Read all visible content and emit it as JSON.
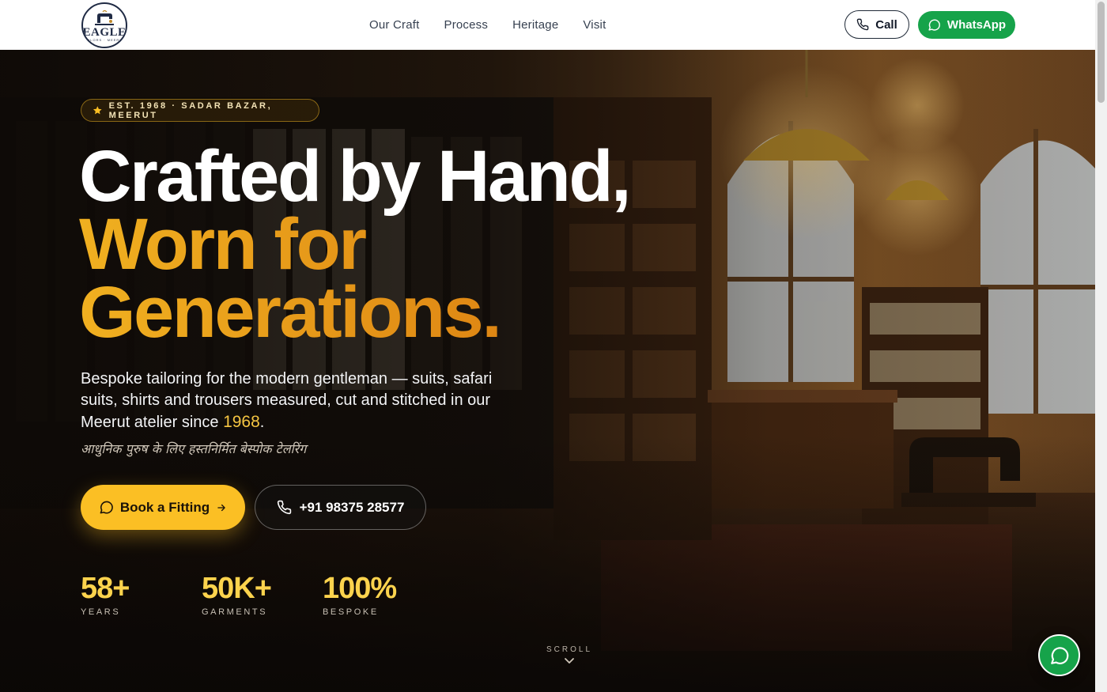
{
  "header": {
    "logo_text": "EAGLE",
    "logo_sub": "TAILORS · MEERUT",
    "nav": [
      "Our Craft",
      "Process",
      "Heritage",
      "Visit"
    ],
    "call_label": "Call",
    "whatsapp_label": "WhatsApp"
  },
  "hero": {
    "badge": "EST. 1968 · SADAR BAZAR, MEERUT",
    "title_line1": "Crafted by Hand,",
    "title_line2": "Worn for",
    "title_line3": "Generations.",
    "lead": "Bespoke tailoring for the modern gentleman — suits, safari suits, shirts and trousers measured, cut and stitched in our Meerut atelier since ",
    "lead_year": "1968",
    "lead_end": ".",
    "hindi": "आधुनिक पुरुष के लिए हस्तनिर्मित बेस्पोक टेलरिंग",
    "book_label": "Book a Fitting",
    "phone_label": "+91 98375 28577"
  },
  "stats": [
    {
      "value": "58+",
      "label": "YEARS"
    },
    {
      "value": "50K+",
      "label": "GARMENTS"
    },
    {
      "value": "100%",
      "label": "BESPOKE"
    }
  ],
  "scroll_label": "SCROLL",
  "colors": {
    "accent_gold": "#fbbf24",
    "whatsapp_green": "#16a34a",
    "title_gold": "#e8a020"
  }
}
